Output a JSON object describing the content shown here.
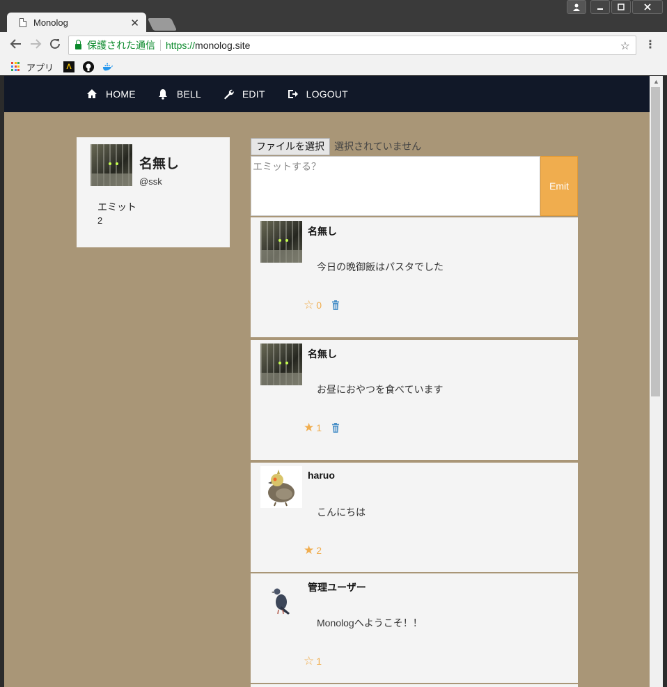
{
  "browser": {
    "tab_title": "Monolog",
    "secure_label": "保護された通信",
    "url_scheme": "https://",
    "url_host": "monolog.site",
    "bookmarks": {
      "apps_label": "アプリ"
    }
  },
  "nav": {
    "items": [
      {
        "label": "HOME",
        "icon": "home-icon"
      },
      {
        "label": "BELL",
        "icon": "bell-icon"
      },
      {
        "label": "EDIT",
        "icon": "wrench-icon"
      },
      {
        "label": "LOGOUT",
        "icon": "logout-icon"
      }
    ]
  },
  "profile": {
    "name": "名無し",
    "handle": "@ssk",
    "emit_label": "エミット",
    "emit_count": "2"
  },
  "composer": {
    "file_button": "ファイルを選択",
    "file_status": "選択されていません",
    "placeholder": "エミットする？",
    "submit_label": "Emit"
  },
  "colors": {
    "page_bg": "#a99677",
    "navbar": "#111828",
    "accent": "#f0ad4e",
    "trash": "#4a90c8"
  },
  "posts": [
    {
      "user": "名無し",
      "text": "今日の晩御飯はパスタでした",
      "favorites": "0",
      "favorited": false,
      "deletable": true,
      "avatar": "cat-photo"
    },
    {
      "user": "名無し",
      "text": "お昼におやつを食べています",
      "favorites": "1",
      "favorited": true,
      "deletable": true,
      "avatar": "cat-photo"
    },
    {
      "user": "haruo",
      "text": "こんにちは",
      "favorites": "2",
      "favorited": true,
      "deletable": false,
      "avatar": "bird-photo"
    },
    {
      "user": "管理ユーザー",
      "text": "Monologへようこそ！！",
      "favorites": "1",
      "favorited": false,
      "deletable": false,
      "avatar": "pigeon-photo"
    }
  ]
}
